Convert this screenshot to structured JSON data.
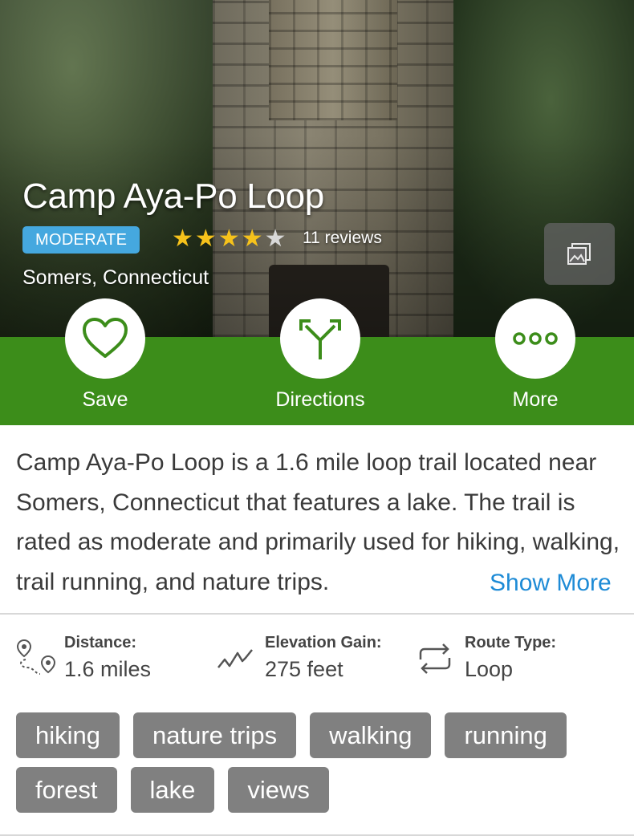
{
  "trail": {
    "name": "Camp Aya-Po Loop",
    "difficulty": "MODERATE",
    "rating": 4,
    "rating_max": 5,
    "reviews": "11 reviews",
    "location": "Somers, Connecticut"
  },
  "actions": {
    "save": "Save",
    "directions": "Directions",
    "more": "More"
  },
  "description": {
    "text": "Camp Aya-Po Loop is a 1.6 mile loop trail located near Somers, Connecticut that features a lake. The trail is rated as moderate and primarily used for hiking, walking, trail running, and nature trips.",
    "show_more": "Show More"
  },
  "stats": {
    "distance": {
      "label": "Distance:",
      "value": "1.6 miles",
      "icon": "route-pins-icon"
    },
    "elevation": {
      "label": "Elevation Gain:",
      "value": "275 feet",
      "icon": "elevation-icon"
    },
    "route_type": {
      "label": "Route Type:",
      "value": "Loop",
      "icon": "loop-arrows-icon"
    }
  },
  "tags": [
    "hiking",
    "nature trips",
    "walking",
    "running",
    "forest",
    "lake",
    "views"
  ],
  "colors": {
    "action_bar": "#3c8d1a",
    "badge": "#45a8df",
    "star_on": "#f6c21b",
    "link": "#1e8bd6",
    "tag_bg": "#808080"
  }
}
